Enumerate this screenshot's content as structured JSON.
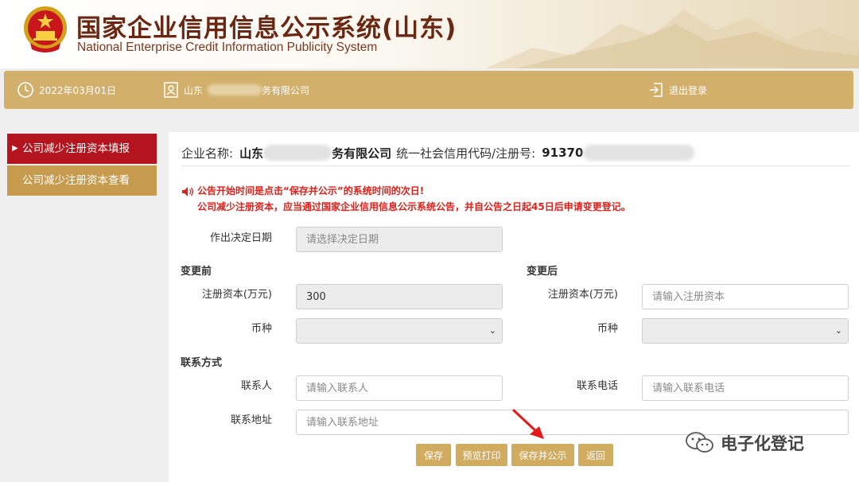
{
  "header": {
    "title_cn": "国家企业信用信息公示系统(山东)",
    "title_en": "National Enterprise Credit Information Publicity System"
  },
  "infobar": {
    "date": "2022年03月01日",
    "company_prefix": "山东",
    "company_suffix": "务有限公司",
    "logout": "退出登录",
    "icons": [
      "clock-icon",
      "user-card-icon",
      "logout-icon"
    ]
  },
  "sidebar": {
    "items": [
      {
        "label": "公司减少注册资本填报",
        "active": true
      },
      {
        "label": "公司减少注册资本查看",
        "active": false
      }
    ]
  },
  "main": {
    "company_label": "企业名称:",
    "company_prefix": "山东",
    "company_suffix": "务有限公司",
    "code_label": "统一社会信用代码/注册号:",
    "code_prefix": "91370",
    "notice": {
      "line1": "公告开始时间是点击“保存并公示”的系统时间的次日!",
      "line2": "公司减少注册资本，应当通过国家企业信用信息公示系统公告，并自公告之日起45日后申请变更登记。"
    },
    "decision_date": {
      "label": "作出决定日期",
      "placeholder": "请选择决定日期"
    },
    "before": {
      "title": "变更前",
      "capital_label": "注册资本(万元)",
      "capital_value": "300",
      "currency_label": "币种"
    },
    "after": {
      "title": "变更后",
      "capital_label": "注册资本(万元)",
      "capital_placeholder": "请输入注册资本",
      "currency_label": "币种"
    },
    "contact": {
      "title": "联系方式",
      "person_label": "联系人",
      "person_placeholder": "请输入联系人",
      "phone_label": "联系电话",
      "phone_placeholder": "请输入联系电话",
      "address_label": "联系地址",
      "address_placeholder": "请输入联系地址"
    },
    "buttons": {
      "save": "保存",
      "preview_print": "预览打印",
      "save_publish": "保存并公示",
      "back": "返回"
    }
  },
  "watermark": {
    "text": "电子化登记",
    "icon": "wechat-icon"
  },
  "colors": {
    "gold": "#d2b06c",
    "button": "#d1ab5f",
    "sidebar_active": "#b3141d",
    "sidebar_normal": "#c69b4e",
    "notice_red": "#e0201b",
    "title_brown": "#6a2712"
  }
}
